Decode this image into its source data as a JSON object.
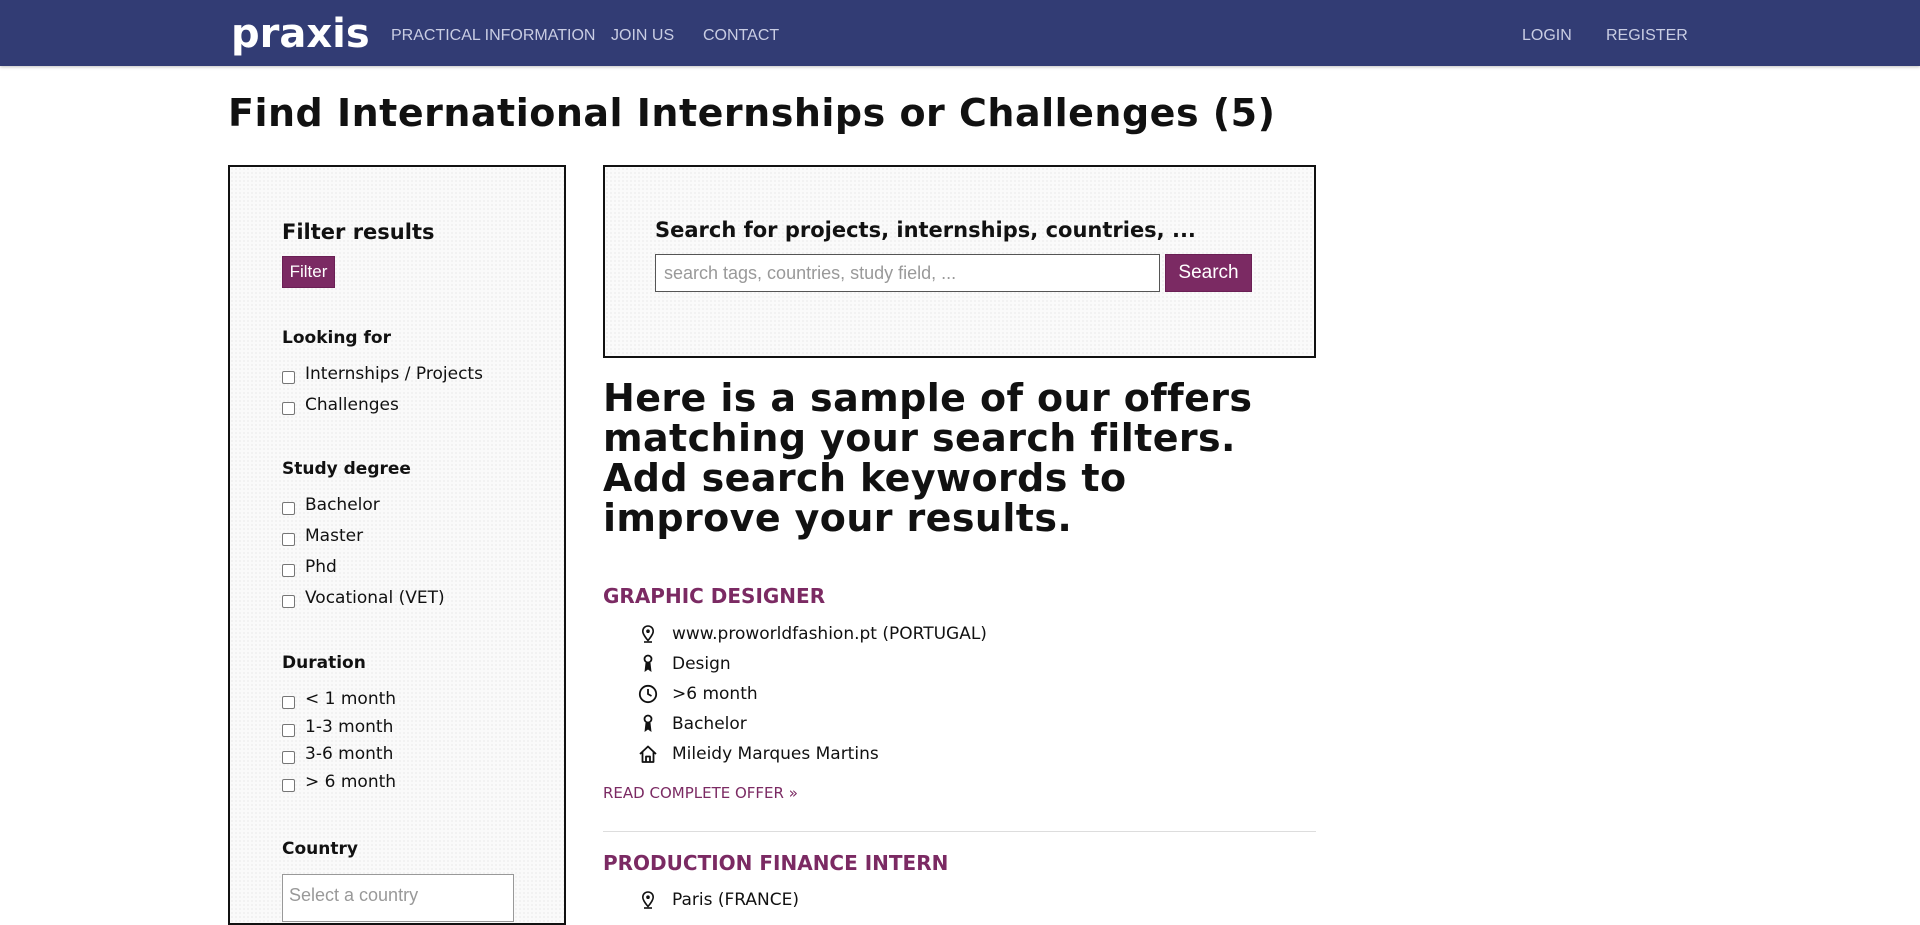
{
  "nav": {
    "logo": "praxis",
    "links": [
      "PRACTICAL INFORMATION",
      "JOIN US",
      "CONTACT"
    ],
    "right_links": [
      "LOGIN",
      "REGISTER"
    ]
  },
  "page_title": "Find International Internships or Challenges (5)",
  "filter": {
    "heading": "Filter results",
    "button": "Filter",
    "looking_for": {
      "title": "Looking for",
      "options": [
        "Internships / Projects",
        "Challenges"
      ]
    },
    "study_degree": {
      "title": "Study degree",
      "options": [
        "Bachelor",
        "Master",
        "Phd",
        "Vocational (VET)"
      ]
    },
    "duration": {
      "title": "Duration",
      "options": [
        "< 1 month",
        "1-3 month",
        "3-6 month",
        "> 6 month"
      ]
    },
    "country": {
      "title": "Country",
      "placeholder": "Select a country"
    }
  },
  "search": {
    "heading": "Search for projects, internships, countries, ...",
    "placeholder": "search tags, countries, study field, ...",
    "button": "Search"
  },
  "intro": "Here is a sample of our offers matching your search filters. Add search keywords to improve your results.",
  "offers": [
    {
      "title": "GRAPHIC DESIGNER",
      "details": [
        {
          "icon": "location-pin-icon",
          "text": "www.proworldfashion.pt (PORTUGAL)"
        },
        {
          "icon": "study-field-icon",
          "text": "Design"
        },
        {
          "icon": "clock-icon",
          "text": ">6 month"
        },
        {
          "icon": "degree-icon",
          "text": "Bachelor"
        },
        {
          "icon": "home-icon",
          "text": "Mileidy Marques Martins"
        }
      ],
      "read_more": "READ COMPLETE OFFER »"
    },
    {
      "title": "PRODUCTION FINANCE INTERN",
      "details": [
        {
          "icon": "location-pin-icon",
          "text": "Paris (FRANCE)"
        }
      ]
    }
  ],
  "colors": {
    "navbar": "#323c74",
    "accent": "#7b2a63"
  }
}
